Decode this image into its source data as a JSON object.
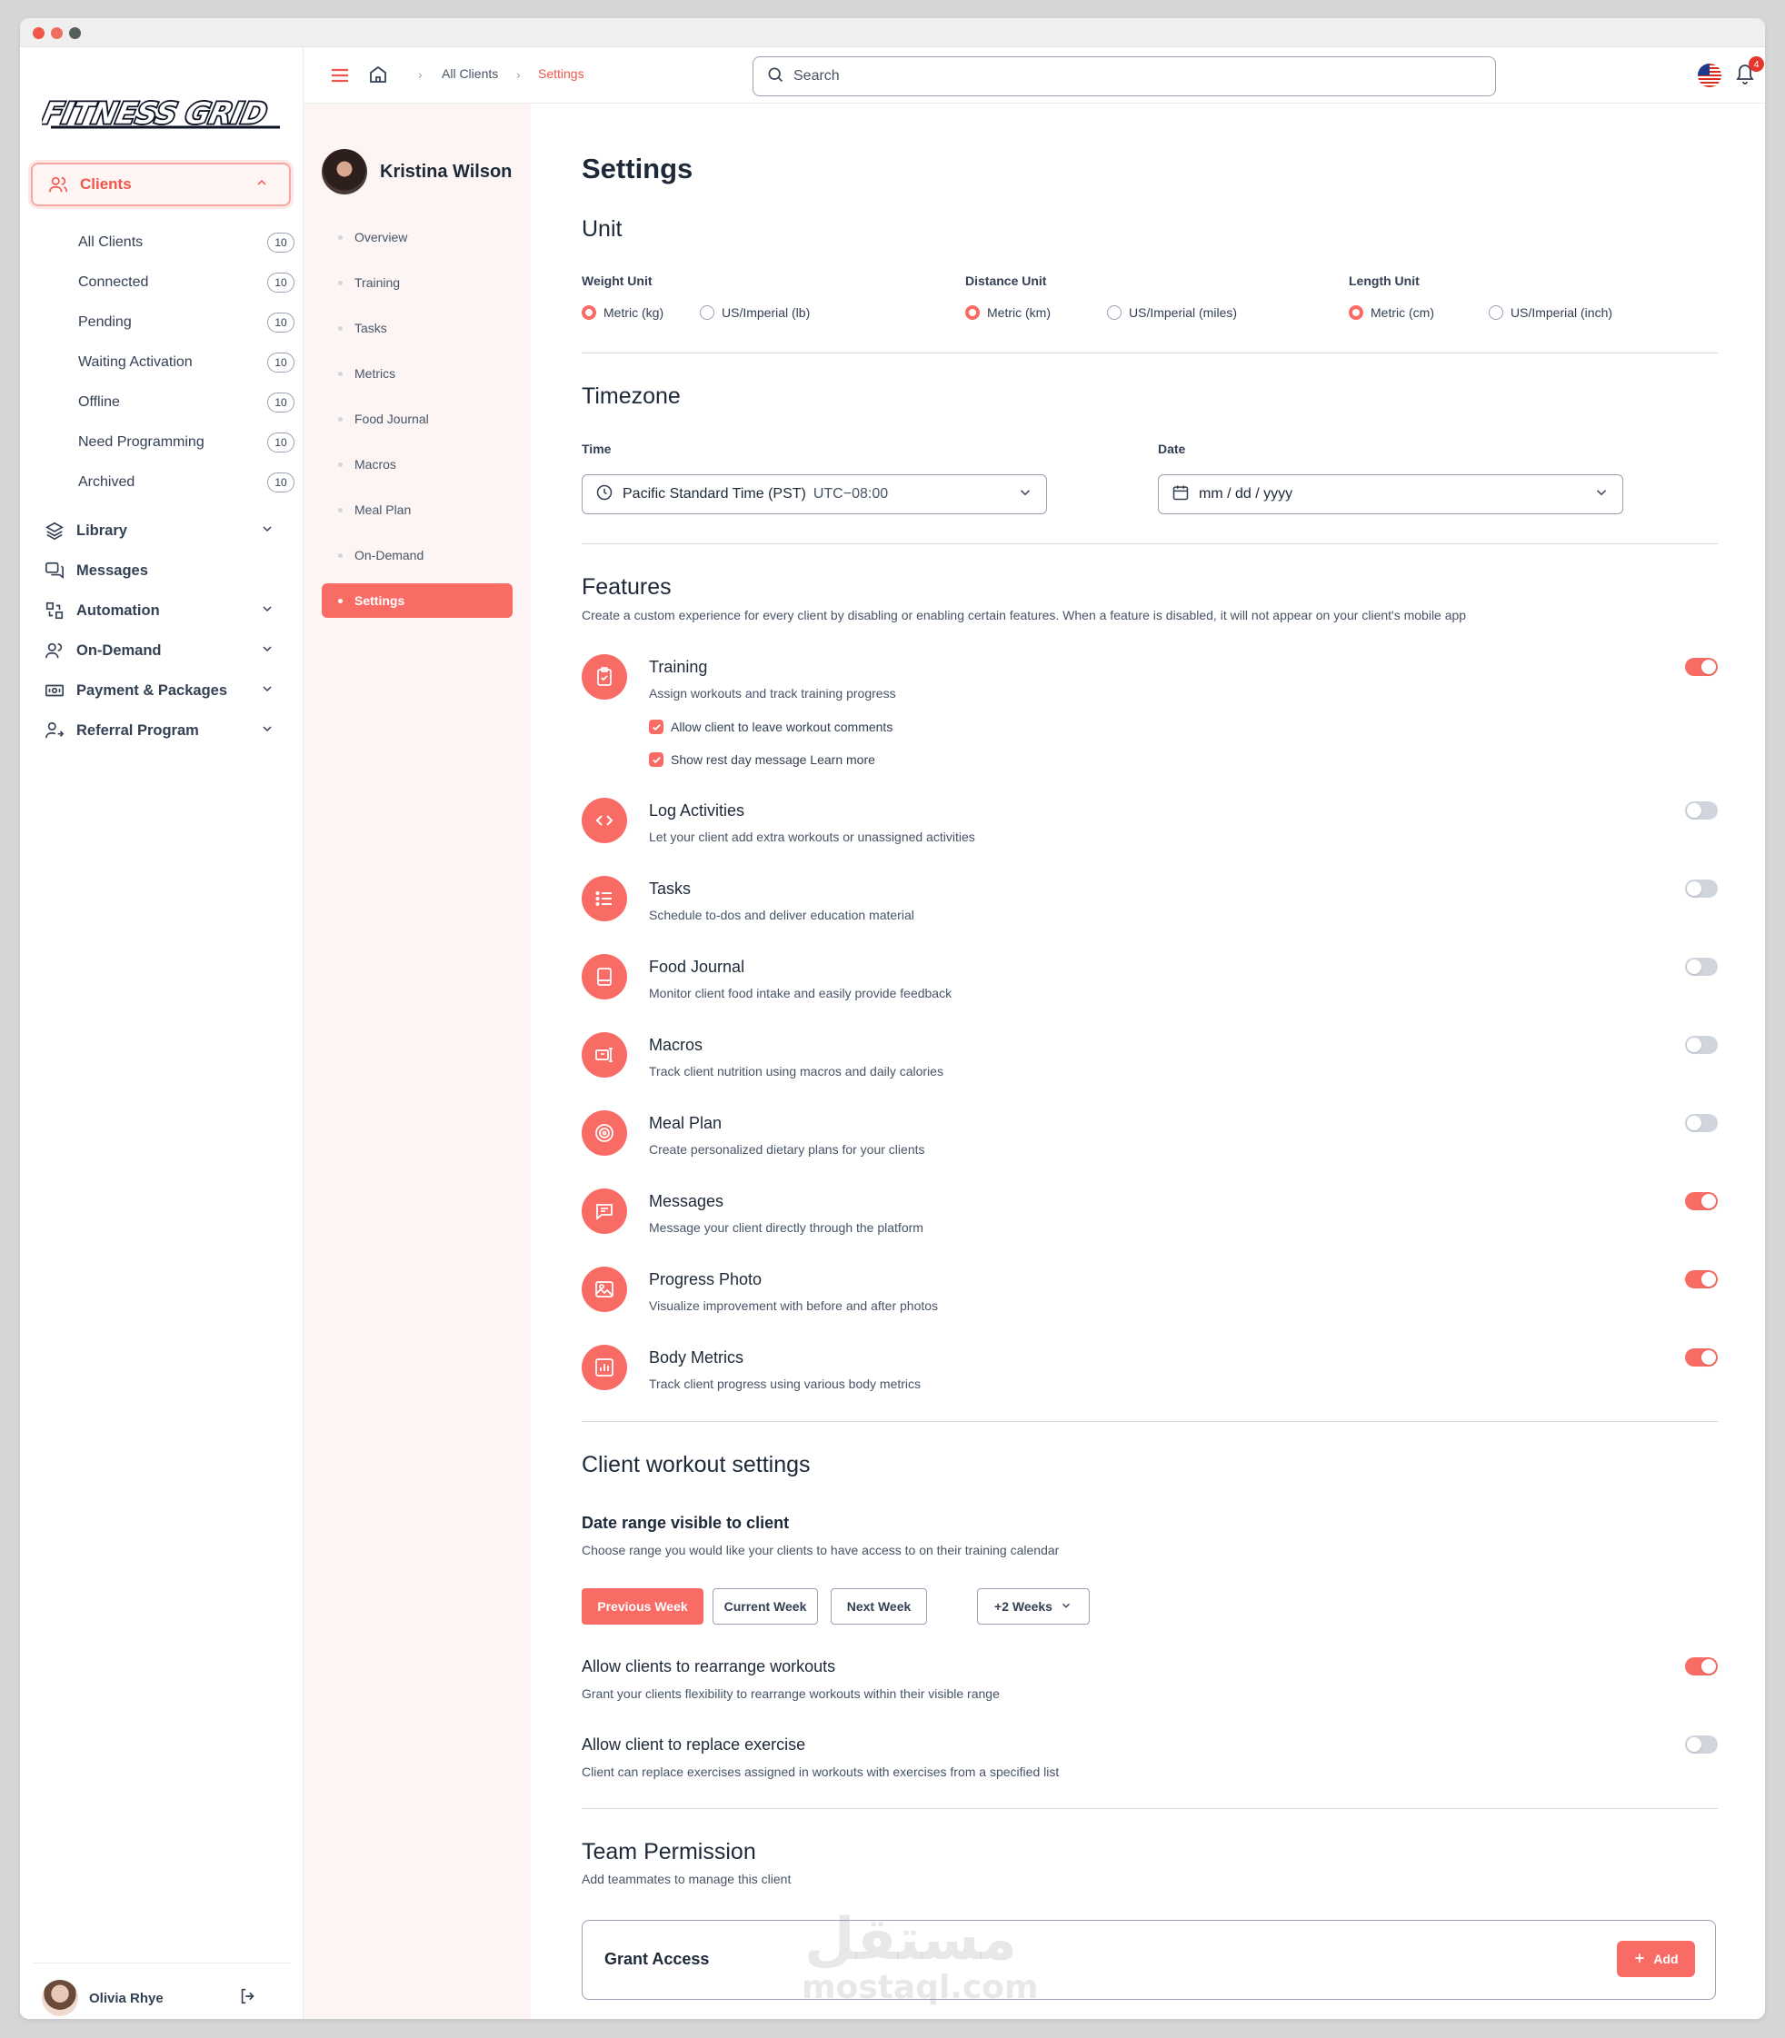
{
  "brand": {
    "logo_text": "FITNESS GRID",
    "accent": "#f96b65",
    "text": "#1d2939"
  },
  "sidebar": {
    "clients_label": "Clients",
    "client_items": [
      {
        "label": "All Clients",
        "count": "10"
      },
      {
        "label": "Connected",
        "count": "10"
      },
      {
        "label": "Pending",
        "count": "10"
      },
      {
        "label": "Waiting Activation",
        "count": "10"
      },
      {
        "label": "Offline",
        "count": "10"
      },
      {
        "label": "Need Programming",
        "count": "10"
      },
      {
        "label": "Archived",
        "count": "10"
      }
    ],
    "items": [
      {
        "label": "Library",
        "icon": "layers-icon"
      },
      {
        "label": "Messages",
        "icon": "messages-icon"
      },
      {
        "label": "Automation",
        "icon": "automation-icon"
      },
      {
        "label": "On-Demand",
        "icon": "users-icon"
      },
      {
        "label": "Payment & Packages",
        "icon": "payment-icon"
      },
      {
        "label": "Referral Program",
        "icon": "referral-icon"
      }
    ],
    "user": {
      "name": "Olivia Rhye"
    }
  },
  "topbar": {
    "breadcrumb": [
      "All Clients",
      "Settings"
    ],
    "search_placeholder": "Search",
    "notification_count": "4"
  },
  "client": {
    "name": "Kristina Wilson",
    "nav": [
      "Overview",
      "Training",
      "Tasks",
      "Metrics",
      "Food Journal",
      "Macros",
      "Meal Plan",
      "On-Demand",
      "Settings"
    ]
  },
  "settings": {
    "title": "Settings",
    "unit": {
      "title": "Unit",
      "weight": {
        "label": "Weight Unit",
        "options": [
          "Metric (kg)",
          "US/Imperial (lb)"
        ],
        "selected": "Metric (kg)"
      },
      "distance": {
        "label": "Distance Unit",
        "options": [
          "Metric (km)",
          "US/Imperial (miles)"
        ],
        "selected": "Metric (km)"
      },
      "length": {
        "label": "Length Unit",
        "options": [
          "Metric (cm)",
          "US/Imperial (inch)"
        ],
        "selected": "Metric (cm)"
      }
    },
    "timezone": {
      "title": "Timezone",
      "time_label": "Time",
      "time_value": "Pacific Standard Time (PST)",
      "time_offset": "UTC−08:00",
      "date_label": "Date",
      "date_value": "mm / dd / yyyy"
    },
    "features": {
      "title": "Features",
      "description": "Create a custom experience for every client by disabling or enabling certain features. When a feature is disabled, it will not appear on your client's mobile app",
      "training_options": [
        "Allow client to leave workout comments",
        "Show rest day message Learn more"
      ],
      "items": [
        {
          "title": "Training",
          "desc": "Assign workouts and track training progress",
          "enabled": true,
          "icon": "clipboard-icon"
        },
        {
          "title": "Log Activities",
          "desc": "Let your client add extra workouts or unassigned activities",
          "enabled": false,
          "icon": "code-icon"
        },
        {
          "title": "Tasks",
          "desc": "Schedule to-dos and deliver education material",
          "enabled": false,
          "icon": "list-icon"
        },
        {
          "title": "Food Journal",
          "desc": "Monitor client food intake and easily provide feedback",
          "enabled": false,
          "icon": "book-icon"
        },
        {
          "title": "Macros",
          "desc": "Track client nutrition using macros and daily calories",
          "enabled": false,
          "icon": "macros-icon"
        },
        {
          "title": "Meal Plan",
          "desc": "Create personalized dietary plans for your clients",
          "enabled": false,
          "icon": "target-icon"
        },
        {
          "title": "Messages",
          "desc": "Message your client directly through the platform",
          "enabled": true,
          "icon": "chat-icon"
        },
        {
          "title": "Progress Photo",
          "desc": "Visualize improvement with before and after photos",
          "enabled": true,
          "icon": "image-icon"
        },
        {
          "title": "Body Metrics",
          "desc": "Track client progress using various body metrics",
          "enabled": true,
          "icon": "chart-icon"
        }
      ]
    },
    "workout": {
      "title": "Client workout settings",
      "range_title": "Date range visible to client",
      "range_desc": "Choose range you would like your clients to have access to on their training calendar",
      "range_buttons": [
        "Previous Week",
        "Current Week",
        "Next Week",
        "+2 Weeks"
      ],
      "range_selected": "Previous Week",
      "rearrange_title": "Allow clients to rearrange workouts",
      "rearrange_desc": "Grant your clients flexibility to rearrange workouts within their visible range",
      "rearrange_enabled": true,
      "replace_title": "Allow client to replace exercise",
      "replace_desc": "Client can replace exercises assigned in workouts with exercises from a specified list",
      "replace_enabled": false
    },
    "team": {
      "title": "Team Permission",
      "desc": "Add teammates to manage this client",
      "grant_label": "Grant Access",
      "add_label": "Add"
    }
  },
  "watermark": {
    "arabic": "مستقل",
    "latin": "mostaql.com"
  }
}
